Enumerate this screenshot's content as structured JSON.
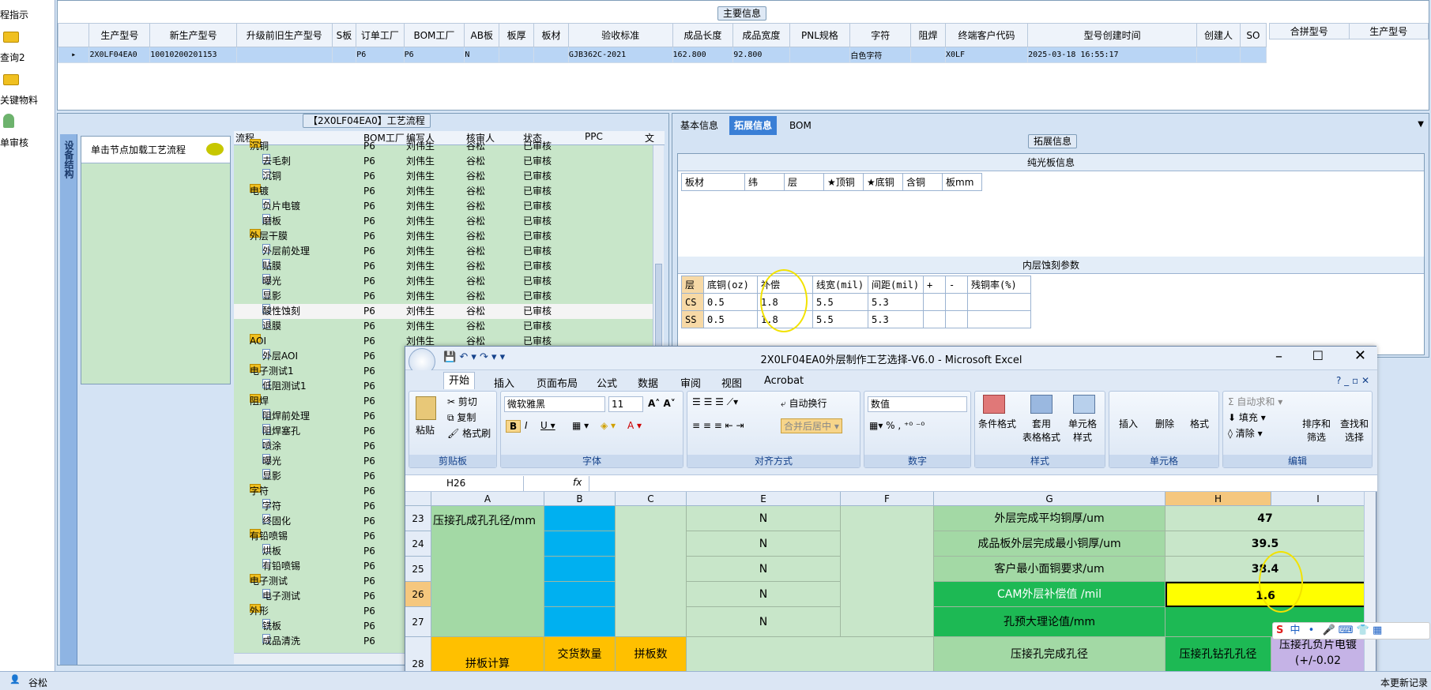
{
  "nav": {
    "items": [
      "程指示",
      "查询2",
      "关键物料",
      "单审核"
    ]
  },
  "main": {
    "title": "主要信息",
    "columns": [
      "生产型号",
      "新生产型号",
      "升级前旧生产型号",
      "S板",
      "订单工厂",
      "BOM工厂",
      "AB板",
      "板厚",
      "板材",
      "验收标准",
      "成品长度",
      "成品宽度",
      "PNL规格",
      "字符",
      "阻焊",
      "终端客户代码",
      "型号创建时间",
      "创建人",
      "SO"
    ],
    "row": [
      "2X0LF04EA0",
      "10010200201153",
      "",
      "",
      "P6",
      "P6",
      "N",
      "",
      "",
      "GJB362C-2021",
      "162.800",
      "92.800",
      "",
      "白色字符",
      "",
      "X0LF",
      "2025-03-18 16:55:17",
      "",
      ""
    ],
    "side_columns": [
      "合拼型号",
      "生产型号"
    ]
  },
  "process": {
    "title": "【2X0LF04EA0】工艺流程",
    "vtab_label": "设备结构",
    "load_hint": "单击节点加载工艺流程",
    "columns": [
      "流程",
      "BOM工厂",
      "编写人",
      "核审人",
      "状态",
      "PPC",
      "文"
    ],
    "rows": [
      {
        "level": 1,
        "name": "沉铜",
        "bom": "P6",
        "writer": "刘伟生",
        "reviewer": "谷松",
        "status": "已审核"
      },
      {
        "level": 2,
        "name": "去毛刺",
        "bom": "P6",
        "writer": "刘伟生",
        "reviewer": "谷松",
        "status": "已审核"
      },
      {
        "level": 2,
        "name": "沉铜",
        "bom": "P6",
        "writer": "刘伟生",
        "reviewer": "谷松",
        "status": "已审核"
      },
      {
        "level": 1,
        "name": "电镀",
        "bom": "P6",
        "writer": "刘伟生",
        "reviewer": "谷松",
        "status": "已审核"
      },
      {
        "level": 2,
        "name": "负片电镀",
        "bom": "P6",
        "writer": "刘伟生",
        "reviewer": "谷松",
        "status": "已审核"
      },
      {
        "level": 2,
        "name": "磨板",
        "bom": "P6",
        "writer": "刘伟生",
        "reviewer": "谷松",
        "status": "已审核"
      },
      {
        "level": 1,
        "name": "外层干膜",
        "bom": "P6",
        "writer": "刘伟生",
        "reviewer": "谷松",
        "status": "已审核"
      },
      {
        "level": 2,
        "name": "外层前处理",
        "bom": "P6",
        "writer": "刘伟生",
        "reviewer": "谷松",
        "status": "已审核"
      },
      {
        "level": 2,
        "name": "贴膜",
        "bom": "P6",
        "writer": "刘伟生",
        "reviewer": "谷松",
        "status": "已审核"
      },
      {
        "level": 2,
        "name": "曝光",
        "bom": "P6",
        "writer": "刘伟生",
        "reviewer": "谷松",
        "status": "已审核"
      },
      {
        "level": 2,
        "name": "显影",
        "bom": "P6",
        "writer": "刘伟生",
        "reviewer": "谷松",
        "status": "已审核"
      },
      {
        "level": 2,
        "name": "酸性蚀刻",
        "bom": "P6",
        "writer": "刘伟生",
        "reviewer": "谷松",
        "status": "已审核"
      },
      {
        "level": 2,
        "name": "退膜",
        "bom": "P6",
        "writer": "刘伟生",
        "reviewer": "谷松",
        "status": "已审核"
      },
      {
        "level": 1,
        "name": "AOI",
        "bom": "P6",
        "writer": "刘伟生",
        "reviewer": "谷松",
        "status": "已审核"
      },
      {
        "level": 2,
        "name": "外层AOI",
        "bom": "P6",
        "writer": "",
        "reviewer": "",
        "status": ""
      },
      {
        "level": 1,
        "name": "电子测试1",
        "bom": "P6",
        "writer": "",
        "reviewer": "",
        "status": ""
      },
      {
        "level": 2,
        "name": "低阻测试1",
        "bom": "P6",
        "writer": "",
        "reviewer": "",
        "status": ""
      },
      {
        "level": 1,
        "name": "阻焊",
        "bom": "P6",
        "writer": "",
        "reviewer": "",
        "status": ""
      },
      {
        "level": 2,
        "name": "阻焊前处理",
        "bom": "P6",
        "writer": "",
        "reviewer": "",
        "status": ""
      },
      {
        "level": 2,
        "name": "阻焊塞孔",
        "bom": "P6",
        "writer": "",
        "reviewer": "",
        "status": ""
      },
      {
        "level": 2,
        "name": "喷涂",
        "bom": "P6",
        "writer": "",
        "reviewer": "",
        "status": ""
      },
      {
        "level": 2,
        "name": "曝光",
        "bom": "P6",
        "writer": "",
        "reviewer": "",
        "status": ""
      },
      {
        "level": 2,
        "name": "显影",
        "bom": "P6",
        "writer": "",
        "reviewer": "",
        "status": ""
      },
      {
        "level": 1,
        "name": "字符",
        "bom": "P6",
        "writer": "",
        "reviewer": "",
        "status": ""
      },
      {
        "level": 2,
        "name": "字符",
        "bom": "P6",
        "writer": "",
        "reviewer": "",
        "status": ""
      },
      {
        "level": 2,
        "name": "终固化",
        "bom": "P6",
        "writer": "",
        "reviewer": "",
        "status": ""
      },
      {
        "level": 1,
        "name": "有铅喷锡",
        "bom": "P6",
        "writer": "",
        "reviewer": "",
        "status": ""
      },
      {
        "level": 2,
        "name": "烘板",
        "bom": "P6",
        "writer": "",
        "reviewer": "",
        "status": ""
      },
      {
        "level": 2,
        "name": "有铅喷锡",
        "bom": "P6",
        "writer": "",
        "reviewer": "",
        "status": ""
      },
      {
        "level": 1,
        "name": "电子测试",
        "bom": "P6",
        "writer": "",
        "reviewer": "",
        "status": ""
      },
      {
        "level": 2,
        "name": "电子测试",
        "bom": "P6",
        "writer": "",
        "reviewer": "",
        "status": ""
      },
      {
        "level": 1,
        "name": "外形",
        "bom": "P6",
        "writer": "",
        "reviewer": "",
        "status": ""
      },
      {
        "level": 2,
        "name": "铣板",
        "bom": "P6",
        "writer": "",
        "reviewer": "",
        "status": ""
      },
      {
        "level": 2,
        "name": "成品清洗",
        "bom": "P6",
        "writer": "",
        "reviewer": "",
        "status": ""
      }
    ]
  },
  "right": {
    "tabs": [
      "基本信息",
      "拓展信息",
      "BOM"
    ],
    "active_tab": 1,
    "section_title": "拓展信息",
    "pure_title": "纯光板信息",
    "pure_columns": [
      "板材",
      "纬",
      "层",
      "★顶铜",
      "★底铜",
      "含铜",
      "板mm"
    ],
    "inner_title": "内层蚀刻参数",
    "inner_columns": [
      "层",
      "底铜(oz)",
      "补偿",
      "线宽(mil)",
      "间距(mil)",
      "+",
      "-",
      "残铜率(%)"
    ],
    "inner_rows": [
      [
        "CS",
        "0.5",
        "1.8",
        "5.5",
        "5.3",
        "",
        "",
        ""
      ],
      [
        "SS",
        "0.5",
        "1.8",
        "5.5",
        "5.3",
        "",
        "",
        ""
      ]
    ]
  },
  "excel": {
    "title": "2X0LF04EA0外层制作工艺选择-V6.0 - Microsoft Excel",
    "tabs": [
      "开始",
      "插入",
      "页面布局",
      "公式",
      "数据",
      "审阅",
      "视图",
      "Acrobat"
    ],
    "clipboard": {
      "paste": "粘贴",
      "cut": "剪切",
      "copy": "复制",
      "painter": "格式刷",
      "label": "剪贴板"
    },
    "font": {
      "name": "微软雅黑",
      "size": "11",
      "label": "字体"
    },
    "align": {
      "wrap": "自动换行",
      "merge": "合并后居中",
      "label": "对齐方式"
    },
    "number": {
      "format": "数值",
      "label": "数字"
    },
    "styles": {
      "cond": "条件格式",
      "table": "套用\n表格格式",
      "cell": "单元格\n样式",
      "label": "样式"
    },
    "cells": {
      "insert": "插入",
      "delete": "删除",
      "format": "格式",
      "label": "单元格"
    },
    "edit": {
      "autosum": "自动求和",
      "fill": "填充",
      "clear": "清除",
      "sort": "排序和\n筛选",
      "find": "查找和\n选择",
      "label": "编辑"
    },
    "namebox": "H26",
    "fx": "fx",
    "columns": [
      "A",
      "B",
      "C",
      "E",
      "F",
      "G",
      "H",
      "I"
    ],
    "rows": [
      "23",
      "24",
      "25",
      "26",
      "27",
      "28"
    ],
    "merged_a": "压接孔成孔孔径/mm",
    "n_label": "N",
    "g": [
      "外层完成平均铜厚/um",
      "成品板外层完成最小铜厚/um",
      "客户最小面铜要求/um",
      "CAM外层补偿值 /mil",
      "孔预大理论值/mm",
      "压接孔完成孔径"
    ],
    "h": [
      "47",
      "39.5",
      "38.4",
      "1.6",
      "",
      ""
    ],
    "h28": "压接孔钻孔孔径",
    "i28": "压接孔负片电镀\n(+/-0.02",
    "a28": "拼板计算",
    "b28": "交货数量",
    "c28": "拼板数"
  },
  "status": {
    "user": "谷松",
    "right_text": "本更新记录"
  },
  "ime": [
    "中",
    "•"
  ]
}
